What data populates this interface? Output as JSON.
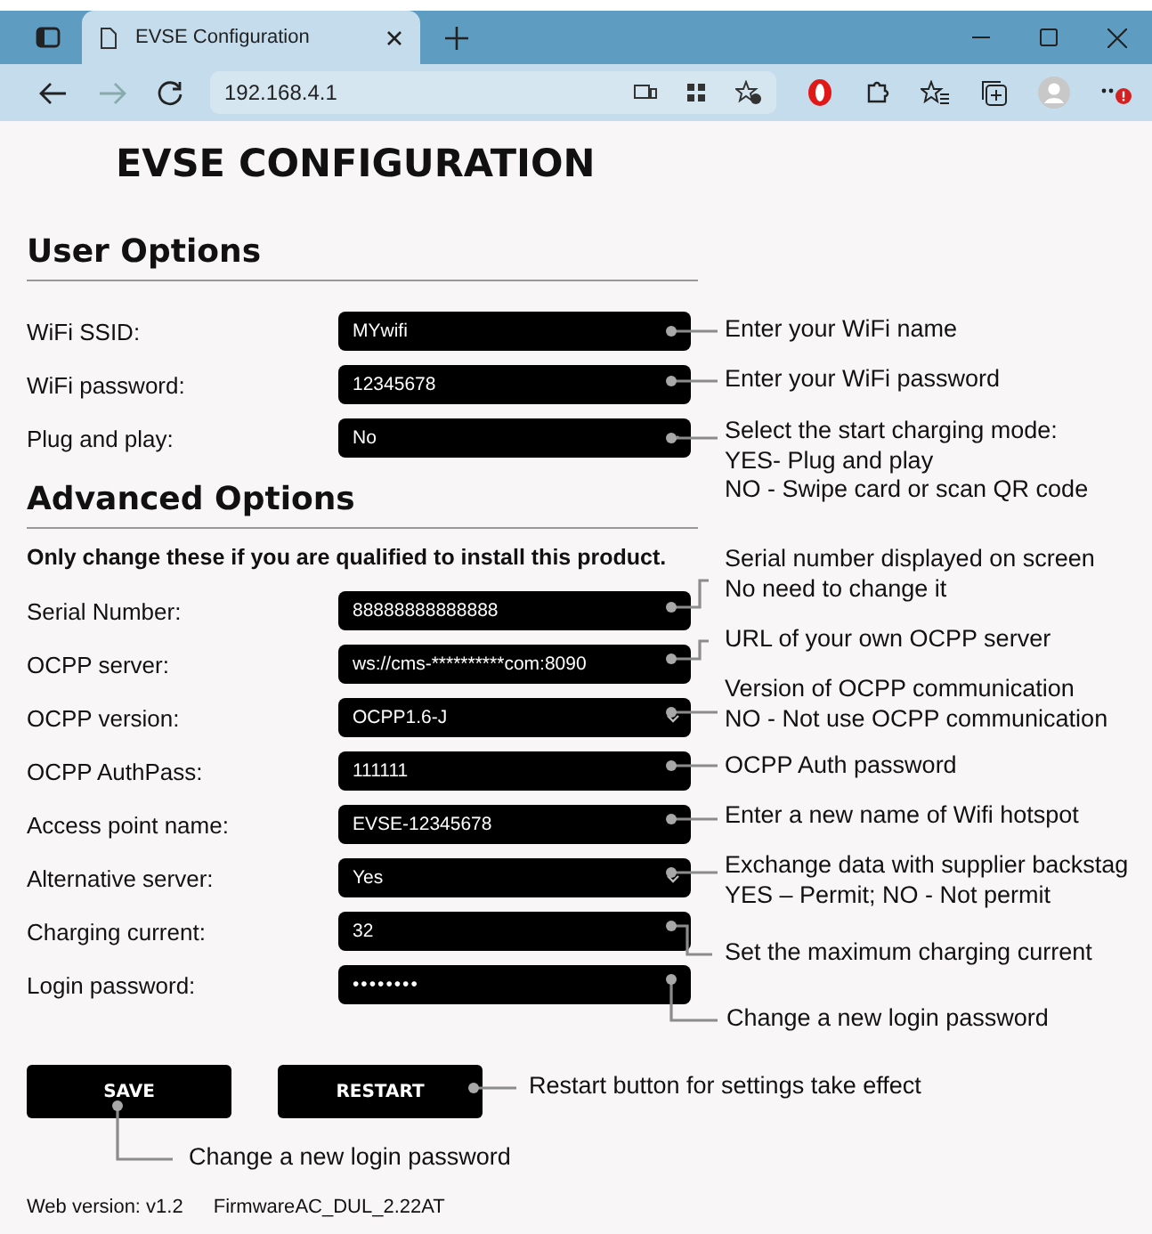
{
  "browser": {
    "tab_title": "EVSE Configuration",
    "url": "192.168.4.1"
  },
  "title": "EVSE CONFIGURATION",
  "user_options": {
    "heading": "User Options",
    "fields": [
      {
        "label": "WiFi SSID:",
        "value": "MYwifi",
        "kind": "text"
      },
      {
        "label": "WiFi password:",
        "value": "12345678",
        "kind": "text"
      },
      {
        "label": "Plug and play:",
        "value": "No",
        "kind": "select"
      }
    ]
  },
  "advanced_options": {
    "heading": "Advanced Options",
    "note": "Only change these if you are qualified to install this product.",
    "fields": [
      {
        "label": "Serial Number:",
        "value": "88888888888888",
        "kind": "text"
      },
      {
        "label": "OCPP server:",
        "value": "ws://cms-**********com:8090",
        "kind": "text"
      },
      {
        "label": "OCPP version:",
        "value": "OCPP1.6-J",
        "kind": "select"
      },
      {
        "label": "OCPP AuthPass:",
        "value": "111111",
        "kind": "text"
      },
      {
        "label": "Access point name:",
        "value": "EVSE-12345678",
        "kind": "text"
      },
      {
        "label": "Alternative server:",
        "value": "Yes",
        "kind": "select"
      },
      {
        "label": "Charging current:",
        "value": "32",
        "kind": "text"
      },
      {
        "label": "Login password:",
        "value": "••••••••",
        "kind": "password"
      }
    ]
  },
  "buttons": [
    "SAVE",
    "RESTART"
  ],
  "annotations": [
    {
      "lines": [
        "Enter your WiFi name"
      ]
    },
    {
      "lines": [
        "Enter your WiFi password"
      ]
    },
    {
      "lines": [
        "Select the start charging mode:",
        "YES- Plug and play",
        "NO - Swipe card or scan QR code"
      ]
    },
    {
      "lines": [
        "Serial number displayed on screen",
        "No need to change it"
      ]
    },
    {
      "lines": [
        "URL of your own OCPP server"
      ]
    },
    {
      "lines": [
        "Version of OCPP communication",
        "NO - Not use OCPP communication"
      ]
    },
    {
      "lines": [
        "OCPP Auth password"
      ]
    },
    {
      "lines": [
        "Enter a new name of  Wifi hotspot"
      ]
    },
    {
      "lines": [
        "Exchange data with supplier backstag",
        "YES – Permit; NO  - Not permit"
      ]
    },
    {
      "lines": [
        "Set the maximum charging current"
      ]
    },
    {
      "lines": [
        "Change a new login password"
      ]
    },
    {
      "lines": [
        "Restart button for settings take effect"
      ]
    },
    {
      "lines": [
        "Change a new login password"
      ]
    }
  ],
  "footer": {
    "web_version": "Web version: v1.2",
    "firmware_label": "Firmware",
    "firmware_value": "AC_DUL_2.22AT"
  }
}
